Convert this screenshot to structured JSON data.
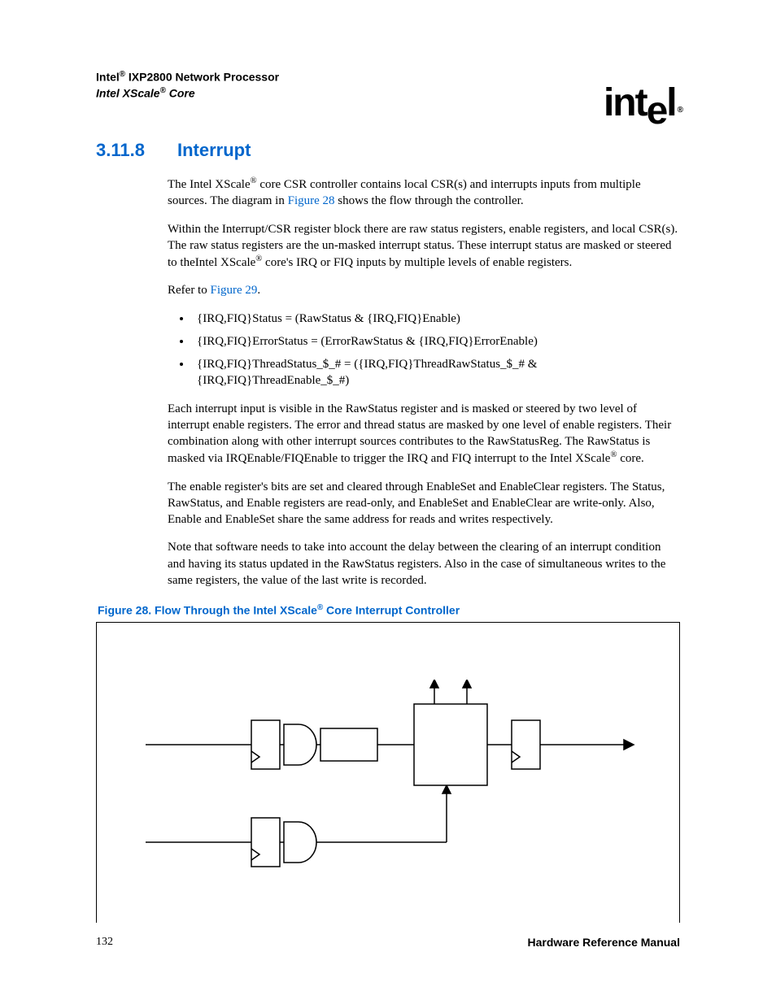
{
  "header": {
    "line1_pre": "Intel",
    "line1_post": " IXP2800 Network Processor",
    "line2_pre": "Intel XScale",
    "line2_post": " Core",
    "logo_text": "intel",
    "logo_reg": "®"
  },
  "section": {
    "number": "3.11.8",
    "title": "Interrupt"
  },
  "para1_a": "The Intel XScale",
  "para1_b": " core CSR controller contains local CSR(s) and interrupts inputs from multiple sources. The diagram in ",
  "para1_fig": "Figure 28",
  "para1_c": " shows the flow through the controller.",
  "para2_a": "Within the Interrupt/CSR register block there are raw status registers, enable registers, and local CSR(s). The raw status registers are the un-masked interrupt status. These interrupt status are masked or steered to theIntel XScale",
  "para2_b": " core's IRQ or FIQ inputs by multiple levels of enable registers.",
  "para3_a": "Refer to ",
  "para3_fig": "Figure 29",
  "para3_b": ".",
  "bullets": [
    "{IRQ,FIQ}Status = (RawStatus & {IRQ,FIQ}Enable)",
    "{IRQ,FIQ}ErrorStatus = (ErrorRawStatus & {IRQ,FIQ}ErrorEnable)",
    "{IRQ,FIQ}ThreadStatus_$_# = ({IRQ,FIQ}ThreadRawStatus_$_# & {IRQ,FIQ}ThreadEnable_$_#)"
  ],
  "para4_a": "Each interrupt input is visible in the RawStatus register and is masked or steered by two level of interrupt enable registers. The error and thread status are masked by one level of enable registers. Their combination along with other interrupt sources contributes to the RawStatusReg. The RawStatus is masked via IRQEnable/FIQEnable to trigger the IRQ and FIQ interrupt to the Intel XScale",
  "para4_b": " core.",
  "para5": "The enable register's bits are set and cleared through EnableSet and EnableClear registers. The Status, RawStatus, and Enable registers are read-only, and EnableSet and EnableClear are write-only. Also, Enable and EnableSet share the same address for reads and writes respectively.",
  "para6": "Note that software needs to take into account the delay between the clearing of an interrupt condition and having its status updated in the RawStatus registers. Also in the case of simultaneous writes to the same registers, the value of the last write is recorded.",
  "figure_caption_a": "Figure 28. Flow Through the Intel XScale",
  "figure_caption_b": " Core Interrupt Controller",
  "reg": "®",
  "footer": {
    "page": "132",
    "doc": "Hardware Reference Manual"
  }
}
